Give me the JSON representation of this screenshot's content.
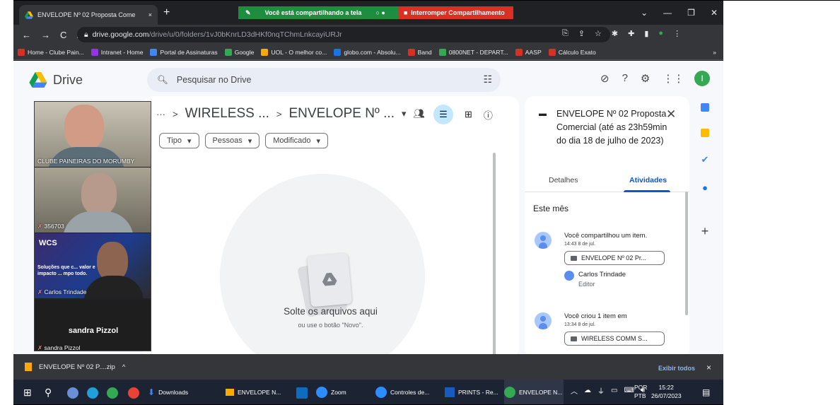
{
  "browser": {
    "tab_title": "ENVELOPE Nº 02 Proposta Come",
    "tab_close": "×",
    "new_tab": "+",
    "share_banner": "Você está compartilhando a tela",
    "stop_share": "Interromper Compartilhamento",
    "url_host": "drive.google.com",
    "url_path": "/drive/u/0/folders/1vJ0bKnrLD3dHKf0nqTChmLnkcayiURJr",
    "bookmarks": [
      {
        "label": "Home - Clube Pain...",
        "color": "#d93025"
      },
      {
        "label": "Intranet - Home",
        "color": "#9334e6"
      },
      {
        "label": "Portal de Assinaturas",
        "color": "#4285f4"
      },
      {
        "label": "Google",
        "color": "#34a853"
      },
      {
        "label": "UOL - O melhor co...",
        "color": "#f9ab00"
      },
      {
        "label": "globo.com - Absolu...",
        "color": "#1a73e8"
      },
      {
        "label": "Band",
        "color": "#d93025"
      },
      {
        "label": "0800NET - DEPART...",
        "color": "#34a853"
      },
      {
        "label": "AASP",
        "color": "#d93025"
      },
      {
        "label": "Cálculo Exato",
        "color": "#d93025"
      }
    ],
    "bookmarks_more": "»"
  },
  "drive": {
    "app_name": "Drive",
    "search_placeholder": "Pesquisar no Drive",
    "breadcrumb_more": "···",
    "breadcrumb_sep": ">",
    "breadcrumb_parent": "WIRELESS ...",
    "breadcrumb_current": "ENVELOPE Nº ...",
    "filters": [
      "Tipo",
      "Pessoas",
      "Modificado"
    ],
    "drop_title": "Solte os arquivos aqui",
    "drop_subtitle": "ou use o botão \"Novo\".",
    "user_initial": "I"
  },
  "details": {
    "title": "ENVELOPE Nº 02 Proposta Comercial (até as 23h59min do dia 18 de julho de 2023)",
    "tab_details": "Detalhes",
    "tab_activity": "Atividades",
    "section": "Este mês",
    "activities": [
      {
        "msg": "Você compartilhou um item.",
        "time": "14:43 8 de jul.",
        "item": "ENVELOPE Nº 02 Pr...",
        "user": "Carlos Trindade",
        "role": "Editor"
      },
      {
        "msg": "Você criou 1 item em",
        "time": "13:34 8 de jul.",
        "item": "WIRELESS COMM S..."
      }
    ]
  },
  "meeting": {
    "participants": [
      {
        "name": "CLUBE PAINEIRAS DO MORUMBY"
      },
      {
        "name": "356703"
      },
      {
        "name": "Carlos Trindade",
        "overlay": "Soluções que c... valor e impacto ... mpo todo."
      },
      {
        "name": "sandra Pizzol",
        "display": "sandra Pizzol"
      }
    ],
    "wcs": "WCS"
  },
  "download_bar": {
    "file": "ENVELOPE Nº 02 P....zip",
    "chevron": "^",
    "show_all": "Exibir todos",
    "close": "×"
  },
  "taskbar": {
    "items": [
      "Downloads",
      "ENVELOPE N...",
      "Zoom",
      "Controles de...",
      "PRINTS - Re...",
      "ENVELOPE N..."
    ],
    "lang": "POR",
    "layout": "PTB",
    "time": "15:22",
    "date": "26/07/2023"
  },
  "colors": {
    "chrome": "#202124",
    "toolbar": "#35363a",
    "drive_bg": "#f6f8fc",
    "accent": "#0b57d0",
    "share_green": "#1e8e3e",
    "share_red": "#d93025"
  }
}
